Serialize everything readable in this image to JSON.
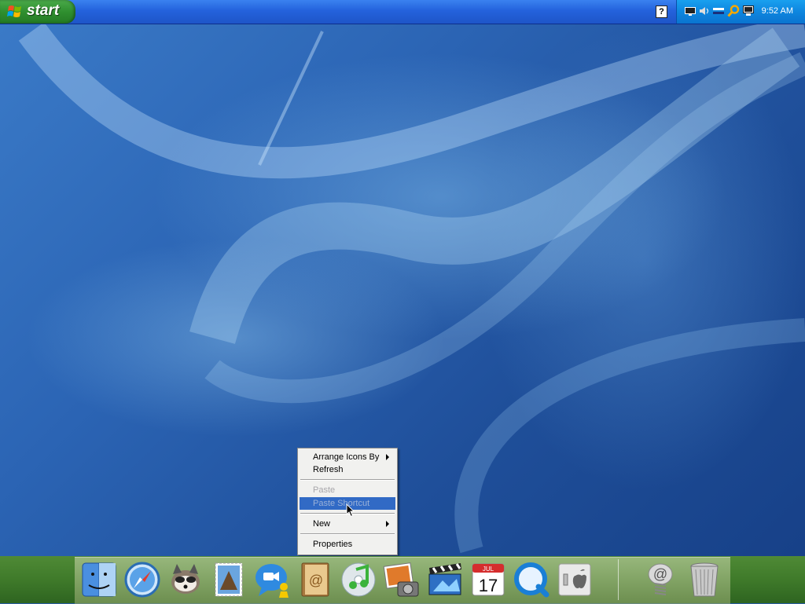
{
  "taskbar": {
    "start_label": "start",
    "help_icon_text": "?",
    "clock": "9:52 AM",
    "tray_icons": [
      "monitor-icon",
      "volume-icon",
      "network-icon",
      "search-icon",
      "display-icon"
    ]
  },
  "context_menu": {
    "items": [
      {
        "label": "Arrange Icons By",
        "submenu": true,
        "enabled": true
      },
      {
        "label": "Refresh",
        "enabled": true
      },
      {
        "label": "Paste",
        "enabled": false
      },
      {
        "label": "Paste Shortcut",
        "enabled": false,
        "highlighted": true
      },
      {
        "label": "New",
        "submenu": true,
        "enabled": true
      },
      {
        "label": "Properties",
        "enabled": true
      }
    ],
    "highlight_color": "#316ac5"
  },
  "dock": {
    "calendar_month": "JUL",
    "calendar_day": "17",
    "icons": [
      "finder-icon",
      "safari-icon",
      "raccoon-icon",
      "mail-stamp-icon",
      "ichat-icon",
      "address-book-icon",
      "itunes-icon",
      "iphoto-icon",
      "imovie-icon",
      "ical-icon",
      "quicktime-icon",
      "system-preferences-icon",
      "mail-spring-icon",
      "trash-icon"
    ]
  },
  "colors": {
    "taskbar": "#2462dc",
    "start_button": "#2f8f2f",
    "tray": "#0e86df"
  }
}
